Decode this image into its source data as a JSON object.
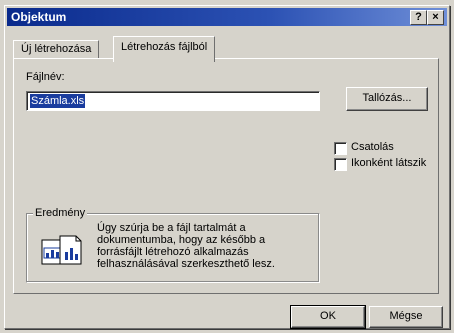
{
  "window": {
    "title": "Objektum",
    "help_label": "?",
    "close_label": "×"
  },
  "tabs": [
    {
      "label": "Új létrehozása",
      "active": false
    },
    {
      "label": "Létrehozás fájlból",
      "active": true
    }
  ],
  "file": {
    "label": "Fájlnév:",
    "value": "Számla.xls",
    "browse_label": "Tallózás..."
  },
  "options": {
    "link_label": "Csatolás",
    "link_checked": false,
    "icon_label": "Ikonként látszik",
    "icon_checked": false
  },
  "result": {
    "legend": "Eredmény",
    "text": "Úgy szúrja be a fájl tartalmát a dokumentumba, hogy az később a forrásfájlt létrehozó alkalmazás felhasználásával szerkeszthető lesz."
  },
  "buttons": {
    "ok_label": "OK",
    "cancel_label": "Mégse"
  },
  "colors": {
    "titlebar": "#0a2a8c",
    "selection": "#1a3c9e",
    "face": "#d6d3cb"
  }
}
